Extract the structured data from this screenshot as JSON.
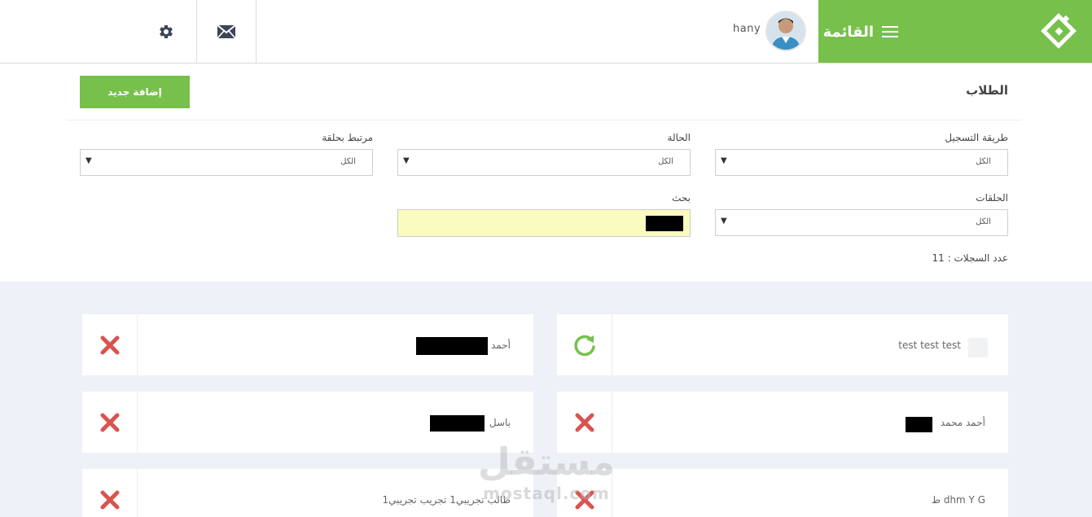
{
  "header": {
    "menu_label": "القائمة",
    "username": "hany",
    "icons": {
      "mail": "envelope-icon",
      "settings": "gear-icon",
      "menu": "hamburger-icon",
      "logo": "logo-icon"
    }
  },
  "page": {
    "title": "الطلاب",
    "add_button": "إضافة جديد"
  },
  "filters": {
    "registration_method": {
      "label": "طريقة التسجيل",
      "value": "الكل"
    },
    "status": {
      "label": "الحالة",
      "value": "الكل"
    },
    "linked_to_circle": {
      "label": "مرتبط بحلقة",
      "value": "الكل"
    },
    "circles": {
      "label": "الحلقات",
      "value": "الكل"
    },
    "search": {
      "label": "بحث",
      "value": ""
    }
  },
  "records_count": "عدد السجلات : 11",
  "students": [
    {
      "name": "test test test",
      "action_icon": "refresh-icon"
    },
    {
      "name": "أحمد",
      "action_icon": "delete-icon"
    },
    {
      "name": "أحمد محمد",
      "action_icon": "delete-icon"
    },
    {
      "name": "باسل",
      "action_icon": "delete-icon"
    },
    {
      "name": "dhm Y G ط",
      "action_icon": "delete-icon"
    },
    {
      "name": "طالب تجريبي1 تجريب تجريبي1",
      "action_icon": "delete-icon"
    }
  ],
  "watermark": {
    "arabic": "مستقل",
    "latin": "mostaql.com"
  },
  "colors": {
    "brand_green": "#77c04b",
    "delete_red": "#d9534f",
    "search_bg": "#fafbbf",
    "cards_bg": "#eef1f8"
  }
}
